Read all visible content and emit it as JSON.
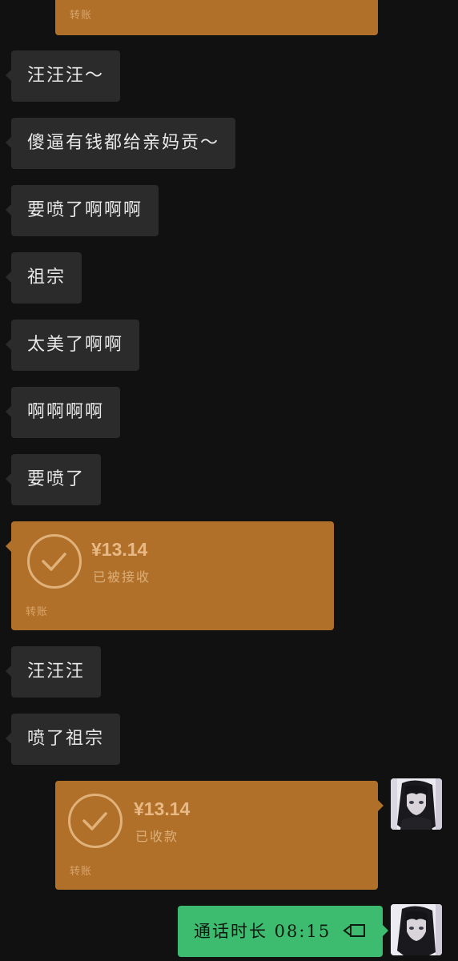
{
  "messages": {
    "top_transfer_footer": "转账",
    "m1": "汪汪汪～",
    "m2": "傻逼有钱都给亲妈贡～",
    "m3": "要喷了啊啊啊",
    "m4": "祖宗",
    "m5": "太美了啊啊",
    "m6": "啊啊啊啊",
    "m7": "要喷了",
    "t1": {
      "amount": "¥13.14",
      "status": "已被接收",
      "footer": "转账"
    },
    "m8": "汪汪汪",
    "m9": "喷了祖宗",
    "t2": {
      "amount": "¥13.14",
      "status": "已收款",
      "footer": "转账"
    },
    "call": "通话时长 08:15"
  },
  "icons": {
    "check": "check-circle-icon",
    "video": "video-call-icon",
    "avatar": "anime-avatar"
  },
  "colors": {
    "background": "#111111",
    "incoming_bubble": "#2b2b2b",
    "transfer": "#b0702a",
    "call_bubble": "#3dbb6e"
  }
}
